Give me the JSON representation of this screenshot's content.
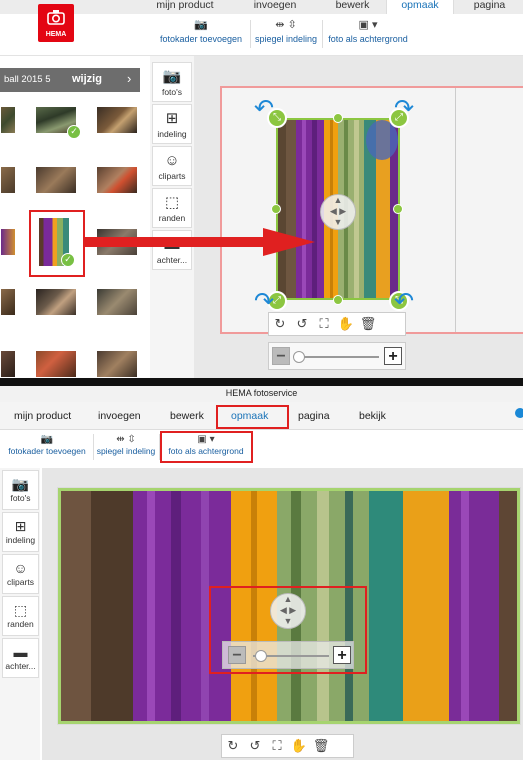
{
  "top": {
    "tabs": [
      "mijn product",
      "invoegen",
      "bewerk",
      "opmaak",
      "pagina"
    ],
    "active_tab": "opmaak",
    "logo_text": "HEMA",
    "tools": [
      {
        "label": "fotokader toevoegen",
        "icon": "photo-frame-icon"
      },
      {
        "label": "spiegel indeling",
        "icon": "mirror-icon"
      },
      {
        "label": "foto als achtergrond",
        "icon": "background-photo-icon"
      }
    ],
    "album": {
      "name": "ball 2015 5",
      "edit_label": "wijzig",
      "next_icon": "›"
    },
    "side_buttons": [
      "foto's",
      "indeling",
      "cliparts",
      "randen",
      "achter..."
    ],
    "zoom": {
      "minus": "−",
      "plus": "+",
      "level": 0.1
    }
  },
  "bottom": {
    "window_title": "HEMA fotoservice",
    "tabs": [
      "mijn product",
      "invoegen",
      "bewerk",
      "opmaak",
      "pagina",
      "bekijk"
    ],
    "active_tab": "opmaak",
    "tools": [
      {
        "label": "fotokader toevoegen",
        "icon": "photo-frame-icon"
      },
      {
        "label": "spiegel indeling",
        "icon": "mirror-icon"
      },
      {
        "label": "foto als achtergrond",
        "icon": "background-photo-icon"
      }
    ],
    "side_buttons": [
      "foto's",
      "indeling",
      "cliparts",
      "randen",
      "achter..."
    ],
    "zoom": {
      "minus": "−",
      "plus": "+",
      "level": 0.1
    }
  },
  "colors": {
    "accent_blue": "#1a73b8",
    "hema_red": "#e30613",
    "selection_green": "#8cc641",
    "highlight_red": "#e02020"
  }
}
